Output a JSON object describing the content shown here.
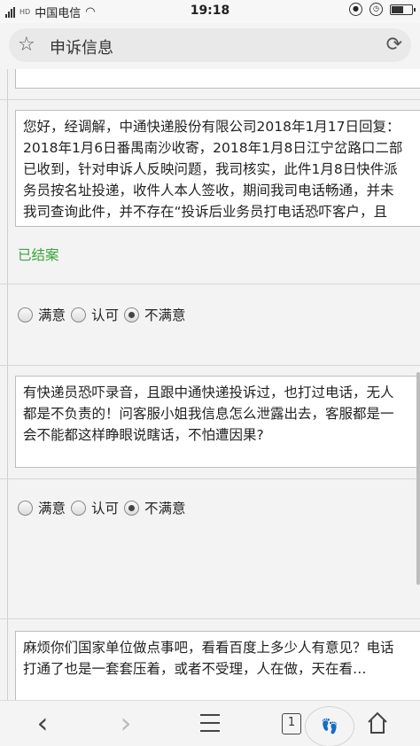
{
  "status_bar": {
    "carrier_sim": "HD",
    "carrier": "中国电信",
    "time": "19:18",
    "battery_level": 0.6
  },
  "address_bar": {
    "title": "申诉信息",
    "star_icon": "star-icon",
    "refresh_icon": "refresh-icon"
  },
  "reply": {
    "lines": [
      "您好，经调解，中通快递股份有限公司2018年1月17日回复：",
      "2018年1月6日番禺南沙收寄，2018年1月8日江宁岔路口二部",
      "已收到，针对申诉人反映问题，我司核实，此件1月8日快件派",
      "务员按名址投递，收件人本人签收，期间我司电话畅通，并未",
      "我司查询此件，并不存在“投诉后业务员打电话恐吓客户，且"
    ]
  },
  "case_status": "已结案",
  "rating_1": {
    "options": [
      "满意",
      "认可",
      "不满意"
    ],
    "selected_index": 2
  },
  "comment_1": {
    "lines": [
      "有快递员恐吓录音，且跟中通快递投诉过，也打过电话，无人",
      "都是不负责的！问客服小姐我信息怎么泄露出去，客服都是一",
      "会不能都这样睁眼说瞎话，不怕遭因果?"
    ]
  },
  "rating_2": {
    "options": [
      "满意",
      "认可",
      "不满意"
    ],
    "selected_index": 2
  },
  "comment_2": {
    "lines": [
      "麻烦你们国家单位做点事吧，看看百度上多少人有意见？电话",
      "打通了也是一套套压着，或者不受理，人在做，天在看…"
    ]
  },
  "bottom_nav": {
    "back_icon": "‹",
    "forward_icon": "›",
    "tab_count": "1"
  }
}
